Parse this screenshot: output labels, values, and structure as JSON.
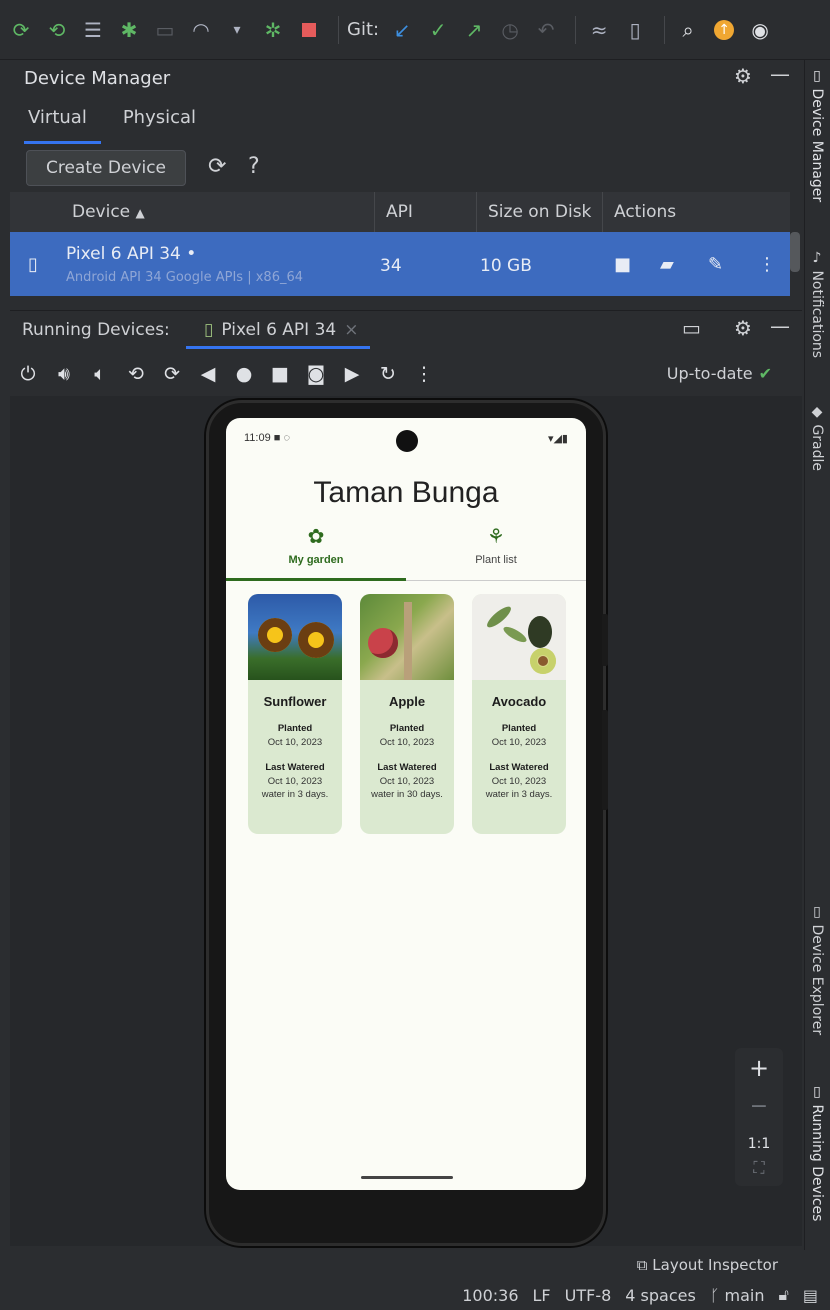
{
  "toolbar": {
    "git_label": "Git:",
    "icons": [
      "apply-changes-icon",
      "apply-code-changes-icon",
      "logcat-icon",
      "debug-icon",
      "attach-debugger-icon",
      "profiler-icon",
      "run-dropdown-icon",
      "attach-process-icon",
      "stop-icon",
      "git-update-icon",
      "git-commit-icon",
      "git-push-icon",
      "git-history-icon",
      "git-rollback-icon",
      "device-mirror-icon",
      "device-manager-icon",
      "search-icon",
      "update-icon",
      "account-icon"
    ]
  },
  "device_manager": {
    "title": "Device Manager",
    "tabs": [
      "Virtual",
      "Physical"
    ],
    "active_tab": "Virtual",
    "create_button": "Create Device",
    "help": "?",
    "columns": [
      "Device",
      "API",
      "Size on Disk",
      "Actions"
    ],
    "sort_indicator": "▲",
    "devices": [
      {
        "name": "Pixel 6 API 34",
        "status_dot": "•",
        "subtitle": "Android API 34 Google APIs | x86_64",
        "api": "34",
        "size": "10 GB"
      }
    ]
  },
  "running_devices": {
    "label": "Running Devices:",
    "tab": "Pixel 6 API 34",
    "close": "×",
    "status": "Up-to-date",
    "more": "⋮"
  },
  "phone": {
    "time": "11:09",
    "app_title": "Taman Bunga",
    "tabs": [
      "My garden",
      "Plant list"
    ],
    "active_tab": "My garden",
    "plants": [
      {
        "name": "Sunflower",
        "planted_label": "Planted",
        "planted_date": "Oct 10, 2023",
        "watered_label": "Last Watered",
        "watered_date": "Oct 10, 2023",
        "water_in": "water in 3 days."
      },
      {
        "name": "Apple",
        "planted_label": "Planted",
        "planted_date": "Oct 10, 2023",
        "watered_label": "Last Watered",
        "watered_date": "Oct 10, 2023",
        "water_in": "water in 30 days."
      },
      {
        "name": "Avocado",
        "planted_label": "Planted",
        "planted_date": "Oct 10, 2023",
        "watered_label": "Last Watered",
        "watered_date": "Oct 10, 2023",
        "water_in": "water in 3 days."
      }
    ]
  },
  "zoom": {
    "plus": "+",
    "minus": "−",
    "one_to_one": "1:1"
  },
  "right_sidebar": [
    "Device Manager",
    "Notifications",
    "Gradle",
    "Device Explorer",
    "Running Devices"
  ],
  "layout_inspector": "Layout Inspector",
  "status_bar": {
    "position": "100:36",
    "line_ending": "LF",
    "encoding": "UTF-8",
    "indent": "4 spaces",
    "branch": "main"
  },
  "colors": {
    "accent": "#3574f0",
    "selection": "#3d6bbf",
    "garden_green": "#2e6b1e",
    "card_bg": "#dbe9d0"
  }
}
